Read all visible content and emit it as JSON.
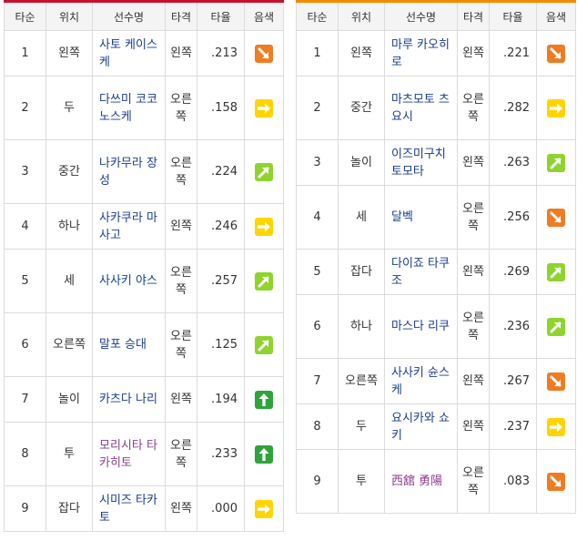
{
  "headers": [
    "타순",
    "위치",
    "선수명",
    "타격",
    "타율",
    "음색"
  ],
  "colors": {
    "red": "#ef7b22",
    "yellow": "#ffd400",
    "lightgreen": "#8fd42e",
    "green": "#2ea43a"
  },
  "left_rows": [
    {
      "order": "1",
      "position": "왼쪽",
      "player": "사토 케이스케",
      "bats": "왼쪽",
      "avg": ".213",
      "trend": "down-right-arrow-icon",
      "color": "red",
      "visited": false
    },
    {
      "order": "2",
      "position": "두",
      "player": "다쓰미 코코노스케",
      "bats": "오른쪽",
      "avg": ".158",
      "trend": "right-arrow-icon",
      "color": "yellow",
      "visited": false
    },
    {
      "order": "3",
      "position": "중간",
      "player": "나카무라 장성",
      "bats": "오른쪽",
      "avg": ".224",
      "trend": "up-right-arrow-icon",
      "color": "lightgreen",
      "visited": false
    },
    {
      "order": "4",
      "position": "하나",
      "player": "사카쿠라 마사고",
      "bats": "왼쪽",
      "avg": ".246",
      "trend": "right-arrow-icon",
      "color": "yellow",
      "visited": false
    },
    {
      "order": "5",
      "position": "세",
      "player": "사사키 야스",
      "bats": "오른쪽",
      "avg": ".257",
      "trend": "up-right-arrow-icon",
      "color": "lightgreen",
      "visited": false
    },
    {
      "order": "6",
      "position": "오른쪽",
      "player": "말포 승대",
      "bats": "오른쪽",
      "avg": ".125",
      "trend": "up-right-arrow-icon",
      "color": "lightgreen",
      "visited": false
    },
    {
      "order": "7",
      "position": "놀이",
      "player": "카츠다 나리",
      "bats": "왼쪽",
      "avg": ".194",
      "trend": "up-arrow-icon",
      "color": "green",
      "visited": false
    },
    {
      "order": "8",
      "position": "투",
      "player": "모리시타 타카히토",
      "bats": "오른쪽",
      "avg": ".233",
      "trend": "up-arrow-icon",
      "color": "green",
      "visited": true
    },
    {
      "order": "9",
      "position": "잡다",
      "player": "시미즈 타카토",
      "bats": "왼쪽",
      "avg": ".000",
      "trend": "right-arrow-icon",
      "color": "yellow",
      "visited": false
    }
  ],
  "right_rows": [
    {
      "order": "1",
      "position": "왼쪽",
      "player": "마루 카오히로",
      "bats": "왼쪽",
      "avg": ".221",
      "trend": "down-right-arrow-icon",
      "color": "red",
      "visited": false
    },
    {
      "order": "2",
      "position": "중간",
      "player": "마츠모토 츠요시",
      "bats": "오른쪽",
      "avg": ".282",
      "trend": "right-arrow-icon",
      "color": "yellow",
      "visited": false
    },
    {
      "order": "3",
      "position": "놀이",
      "player": "이즈미구치 토모타",
      "bats": "왼쪽",
      "avg": ".263",
      "trend": "up-right-arrow-icon",
      "color": "lightgreen",
      "visited": false
    },
    {
      "order": "4",
      "position": "세",
      "player": "달벡",
      "bats": "오른쪽",
      "avg": ".256",
      "trend": "down-right-arrow-icon",
      "color": "red",
      "visited": false
    },
    {
      "order": "5",
      "position": "잡다",
      "player": "다이죠 타쿠조",
      "bats": "왼쪽",
      "avg": ".269",
      "trend": "up-right-arrow-icon",
      "color": "lightgreen",
      "visited": false
    },
    {
      "order": "6",
      "position": "하나",
      "player": "마스다 리쿠",
      "bats": "오른쪽",
      "avg": ".236",
      "trend": "up-right-arrow-icon",
      "color": "lightgreen",
      "visited": false
    },
    {
      "order": "7",
      "position": "오른쪽",
      "player": "사사키 슌스케",
      "bats": "왼쪽",
      "avg": ".267",
      "trend": "down-right-arrow-icon",
      "color": "red",
      "visited": false
    },
    {
      "order": "8",
      "position": "두",
      "player": "요시카와 쇼키",
      "bats": "왼쪽",
      "avg": ".237",
      "trend": "right-arrow-icon",
      "color": "yellow",
      "visited": false
    },
    {
      "order": "9",
      "position": "투",
      "player": "西舘 勇陽",
      "bats": "오른쪽",
      "avg": ".083",
      "trend": "down-right-arrow-icon",
      "color": "red",
      "visited": true
    }
  ]
}
